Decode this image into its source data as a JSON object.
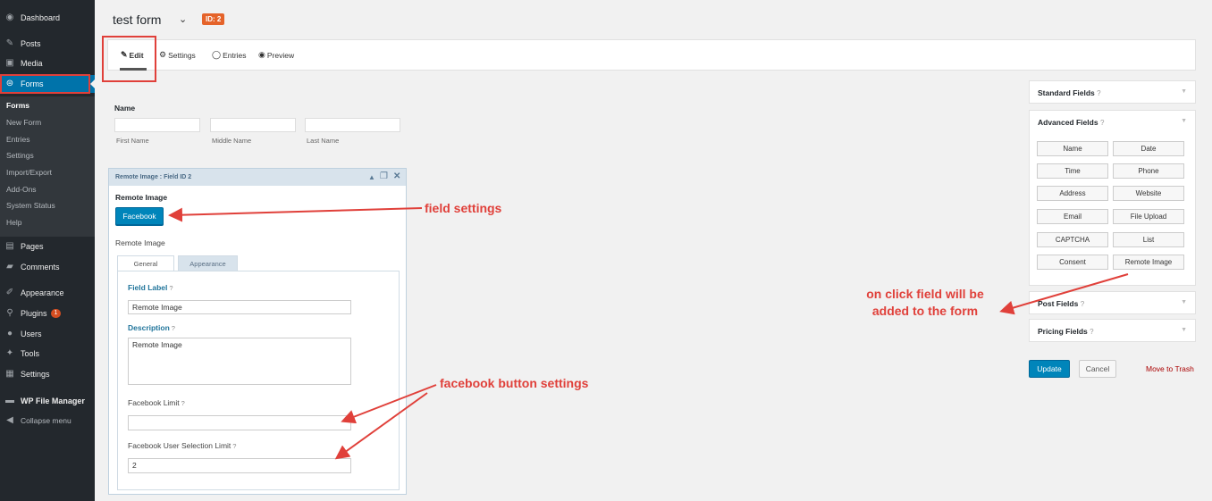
{
  "sidebar": {
    "items": [
      {
        "label": "Dashboard",
        "icon": "dashboard-icon",
        "glyph": "◉"
      },
      {
        "label": "Posts",
        "icon": "pin-icon",
        "glyph": "✎"
      },
      {
        "label": "Media",
        "icon": "media-icon",
        "glyph": "▣"
      },
      {
        "label": "Forms",
        "icon": "forms-icon",
        "glyph": "⊜"
      },
      {
        "label": "Pages",
        "icon": "pages-icon",
        "glyph": "▤"
      },
      {
        "label": "Comments",
        "icon": "comments-icon",
        "glyph": "▰"
      },
      {
        "label": "Appearance",
        "icon": "appearance-icon",
        "glyph": "✐"
      },
      {
        "label": "Plugins",
        "icon": "plugins-icon",
        "glyph": "⚲",
        "badge": "1"
      },
      {
        "label": "Users",
        "icon": "users-icon",
        "glyph": "●"
      },
      {
        "label": "Tools",
        "icon": "tools-icon",
        "glyph": "✦"
      },
      {
        "label": "Settings",
        "icon": "settings-icon",
        "glyph": "▦"
      },
      {
        "label": "WP File Manager",
        "icon": "folder-icon",
        "glyph": "▬"
      },
      {
        "label": "Collapse menu",
        "icon": "collapse-icon",
        "glyph": "◀"
      }
    ],
    "submenu": [
      "Forms",
      "New Form",
      "Entries",
      "Settings",
      "Import/Export",
      "Add-Ons",
      "System Status",
      "Help"
    ]
  },
  "header": {
    "title": "test form",
    "chevron": "⌄",
    "id_badge": "ID: 2"
  },
  "tabs": [
    {
      "label": "Edit",
      "icon": "edit-icon",
      "glyph": "✎"
    },
    {
      "label": "Settings",
      "icon": "gears-icon",
      "glyph": "⚙"
    },
    {
      "label": "Entries",
      "icon": "entries-icon",
      "glyph": "◯"
    },
    {
      "label": "Preview",
      "icon": "eye-icon",
      "glyph": "◉"
    }
  ],
  "name_field": {
    "label": "Name",
    "sublabels": [
      "First Name",
      "Middle Name",
      "Last Name"
    ]
  },
  "field_panel": {
    "header": "Remote Image : Field ID 2",
    "field_name": "Remote Image",
    "button_label": "Facebook",
    "sub_label": "Remote Image",
    "tabs": [
      "General",
      "Appearance"
    ],
    "field_label_title": "Field Label",
    "field_label_value": "Remote Image",
    "description_title": "Description",
    "description_value": "Remote Image",
    "fb_limit_title": "Facebook Limit",
    "fb_limit_value": "",
    "fb_user_limit_title": "Facebook User Selection Limit",
    "fb_user_limit_value": "2",
    "help_glyph": "?"
  },
  "right_panel": {
    "standard_fields": "Standard Fields",
    "advanced_fields": "Advanced Fields",
    "post_fields": "Post Fields",
    "pricing_fields": "Pricing Fields",
    "advanced_buttons": [
      "Name",
      "Date",
      "Time",
      "Phone",
      "Address",
      "Website",
      "Email",
      "File Upload",
      "CAPTCHA",
      "List",
      "Consent",
      "Remote Image"
    ],
    "help_glyph": "?",
    "chevron": "▼"
  },
  "actions": {
    "update": "Update",
    "cancel": "Cancel",
    "trash": "Move to Trash"
  },
  "annotations": {
    "field_settings": "field settings",
    "facebook_settings": "facebook button settings",
    "on_click": "on click field will be added to the form"
  },
  "colors": {
    "sidebar_bg": "#23282d",
    "active_blue": "#0073aa",
    "primary_button": "#0085ba",
    "id_badge": "#e5632a",
    "annotation_red": "#e0403a"
  }
}
